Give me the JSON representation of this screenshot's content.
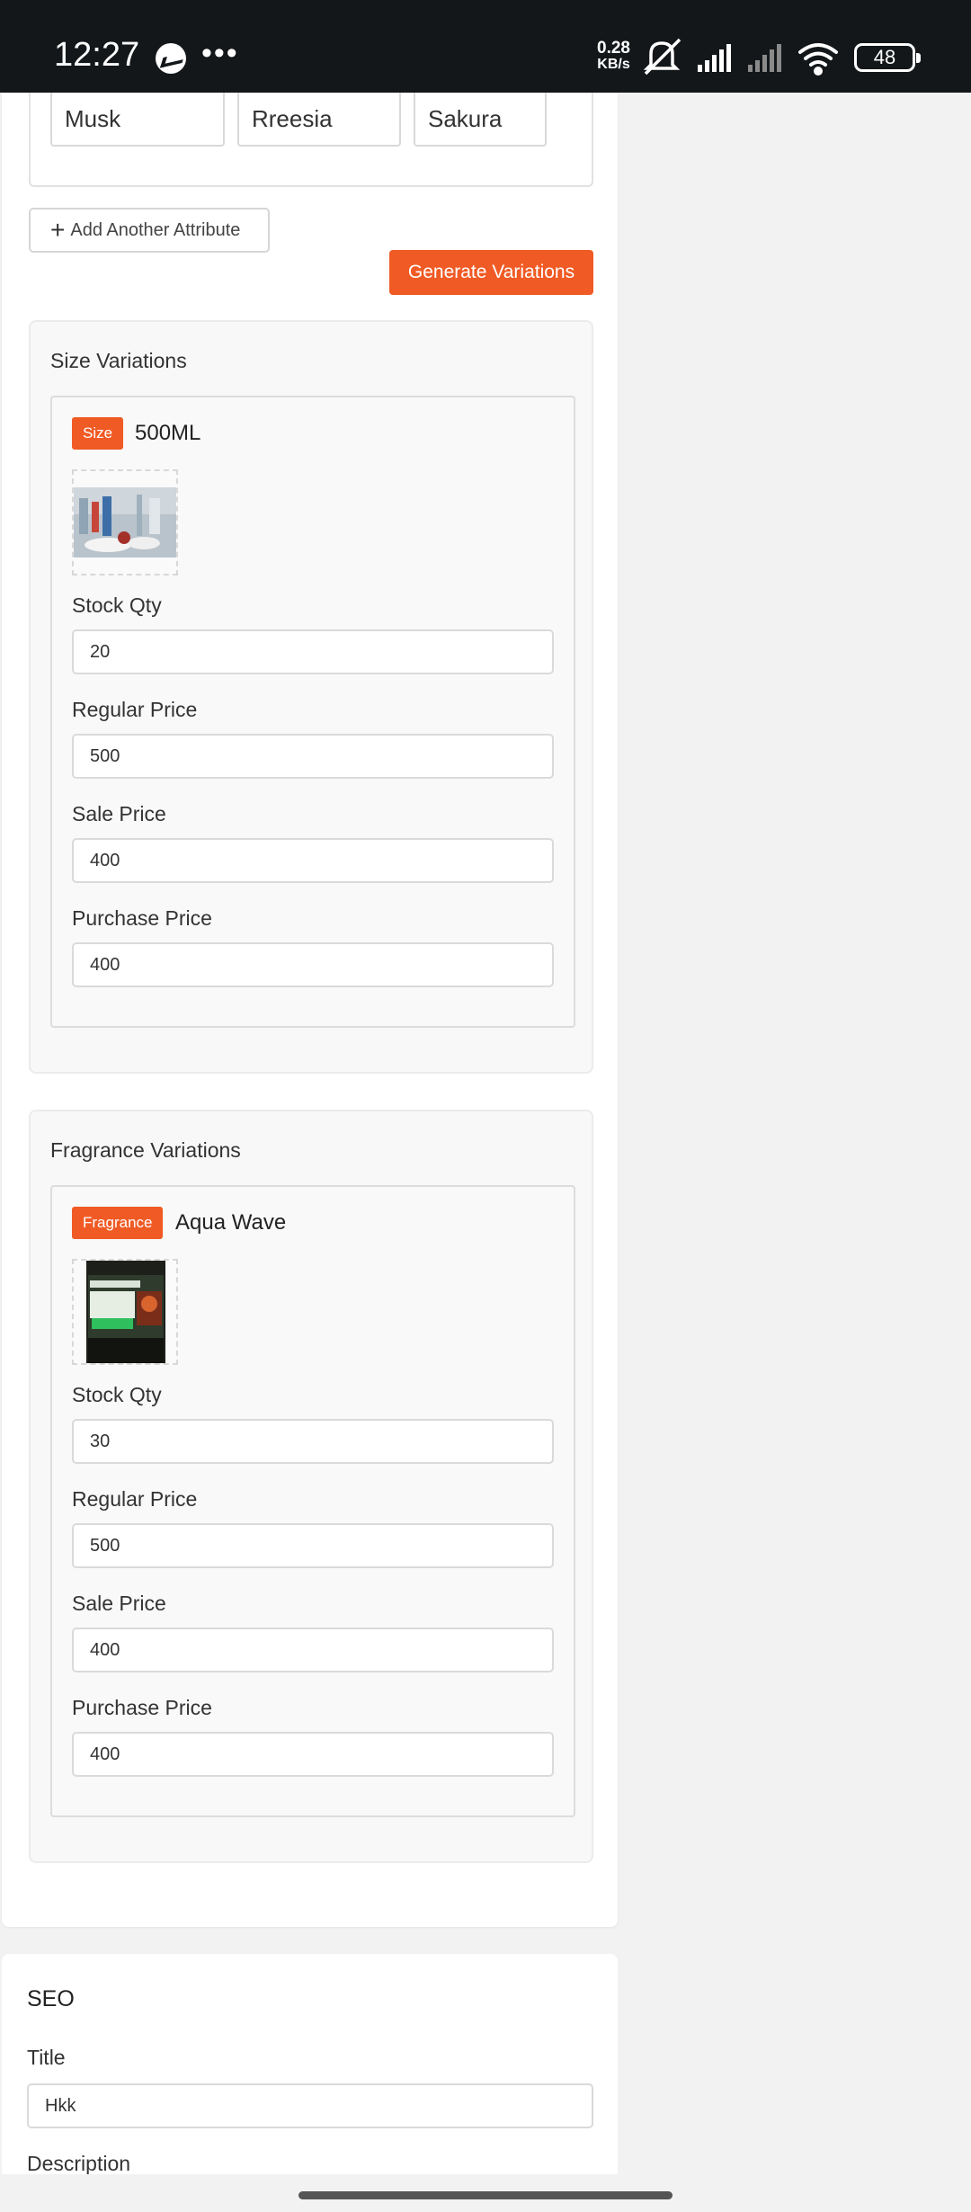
{
  "status_bar": {
    "time": "12:27",
    "more": "•••",
    "speed_value": "0.28",
    "speed_unit": "KB/s",
    "battery": "48",
    "icons": [
      "messenger-icon",
      "mute-icon",
      "signal-icon",
      "signal-icon",
      "wifi-icon",
      "battery-icon"
    ]
  },
  "attributes": {
    "values": [
      "Musk",
      "Rreesia",
      "Sakura"
    ],
    "add_button_label": "Add Another Attribute",
    "generate_button_label": "Generate Variations"
  },
  "size_section": {
    "title": "Size Variations",
    "items": [
      {
        "badge": "Size",
        "name": "500ML",
        "fields": {
          "stock_label": "Stock Qty",
          "stock": "20",
          "regular_label": "Regular Price",
          "regular": "500",
          "sale_label": "Sale Price",
          "sale": "400",
          "purchase_label": "Purchase Price",
          "purchase": "400"
        }
      }
    ]
  },
  "fragrance_section": {
    "title": "Fragrance Variations",
    "items": [
      {
        "badge": "Fragrance",
        "name": "Aqua Wave",
        "fields": {
          "stock_label": "Stock Qty",
          "stock": "30",
          "regular_label": "Regular Price",
          "regular": "500",
          "sale_label": "Sale Price",
          "sale": "400",
          "purchase_label": "Purchase Price",
          "purchase": "400"
        }
      }
    ]
  },
  "seo": {
    "title": "SEO",
    "title_label": "Title",
    "title_value": "Hkk",
    "description_label": "Description"
  },
  "colors": {
    "accent": "#f05a24",
    "status_bar": "#13171a"
  }
}
